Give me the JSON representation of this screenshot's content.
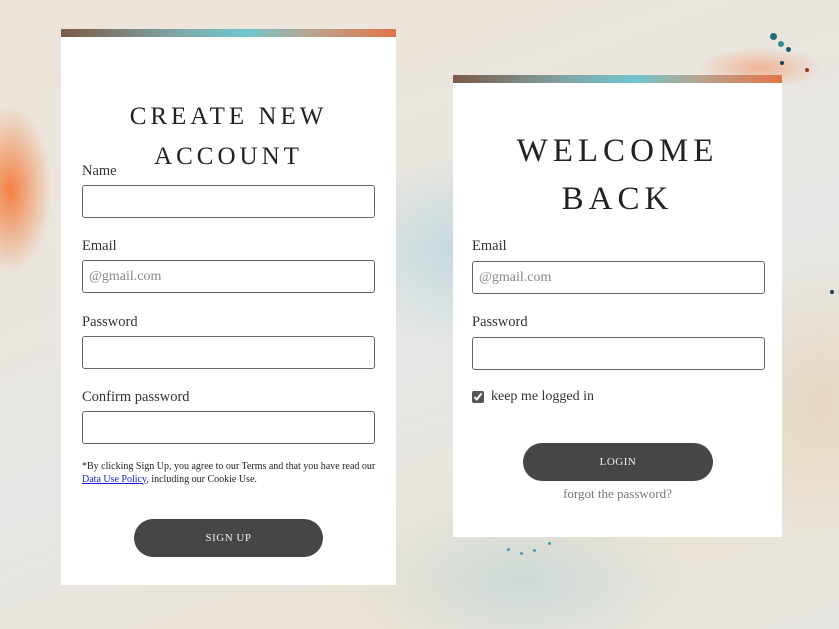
{
  "signup": {
    "title": "Create New Account",
    "name_label": "Name",
    "name_value": "",
    "email_label": "Email",
    "email_placeholder": "@gmail.com",
    "password_label": "Password",
    "confirm_label": "Confirm password",
    "terms_before": "*By clicking Sign Up, you agree to our Terms and that you have read our ",
    "terms_link": "Data Use Policy",
    "terms_after": ", including our Cookie Use.",
    "button_label": "Sign Up"
  },
  "login": {
    "title": "Welcome Back",
    "email_label": "Email",
    "email_placeholder": "@gmail.com",
    "password_label": "Password",
    "remember_label": "keep me logged in",
    "remember_checked": true,
    "button_label": "Login",
    "forgot_label": "forgot the password?"
  },
  "colors": {
    "button_bg": "#474646",
    "accent_bar": [
      "#7b5a45",
      "#6fc6cc",
      "#e2744a"
    ],
    "link": "#1a1ad6"
  }
}
